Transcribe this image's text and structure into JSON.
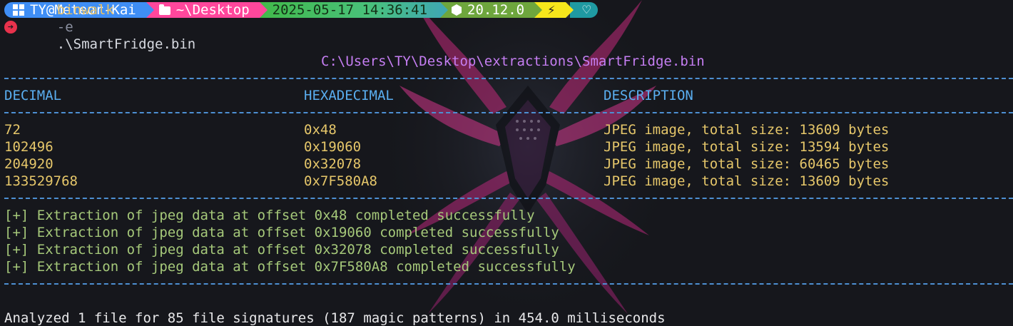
{
  "prompt": {
    "user": "TY@Meteor-Kai",
    "path": "~\\Desktop",
    "datetime": "2025-05-17 14:36:41",
    "node_version": "20.12.0",
    "bolt": "⚡",
    "heart": "♡"
  },
  "command": {
    "name": "binwalk",
    "flag": "-e",
    "arg": ".\\SmartFridge.bin"
  },
  "output": {
    "target": "C:\\Users\\TY\\Desktop\\extractions\\SmartFridge.bin",
    "headers": [
      "DECIMAL",
      "HEXADECIMAL",
      "DESCRIPTION"
    ],
    "rows": [
      {
        "decimal": "72",
        "hex": "0x48",
        "description": "JPEG image, total size: 13609 bytes"
      },
      {
        "decimal": "102496",
        "hex": "0x19060",
        "description": "JPEG image, total size: 13594 bytes"
      },
      {
        "decimal": "204920",
        "hex": "0x32078",
        "description": "JPEG image, total size: 60465 bytes"
      },
      {
        "decimal": "133529768",
        "hex": "0x7F580A8",
        "description": "JPEG image, total size: 13609 bytes"
      }
    ],
    "extractions": [
      "[+] Extraction of jpeg data at offset 0x48 completed successfully",
      "[+] Extraction of jpeg data at offset 0x19060 completed successfully",
      "[+] Extraction of jpeg data at offset 0x32078 completed successfully",
      "[+] Extraction of jpeg data at offset 0x7F580A8 completed successfully"
    ],
    "summary": "Analyzed 1 file for 85 file signatures (187 magic patterns) in 454.0 milliseconds"
  },
  "colors": {
    "background": "#16171c",
    "accent_blue": "#5aaef0",
    "path_purple": "#c57ef2",
    "value_yellow": "#e6c76a",
    "success_green": "#a6c97a"
  }
}
